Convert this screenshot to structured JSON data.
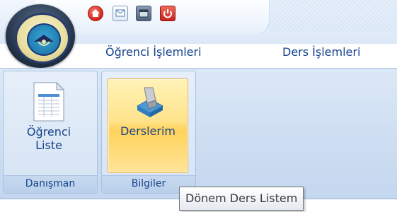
{
  "tabs": [
    {
      "label": "Öğrenci İşlemleri"
    },
    {
      "label": "Ders İşlemleri"
    }
  ],
  "quick_access": [
    {
      "icon": "home-icon"
    },
    {
      "icon": "message-icon"
    },
    {
      "icon": "window-icon"
    },
    {
      "icon": "power-icon"
    }
  ],
  "groups": [
    {
      "label": "Danışman",
      "buttons": [
        {
          "line1": "Öğrenci",
          "line2": "Liste",
          "icon": "list-icon"
        }
      ]
    },
    {
      "label": "Bilgiler",
      "buttons": [
        {
          "label": "Derslerim",
          "icon": "courses-icon"
        }
      ]
    }
  ],
  "tooltip": {
    "text": "Dönem Ders Listem"
  },
  "colors": {
    "ribbon_text": "#15428b",
    "highlight": "#ffd25a"
  }
}
